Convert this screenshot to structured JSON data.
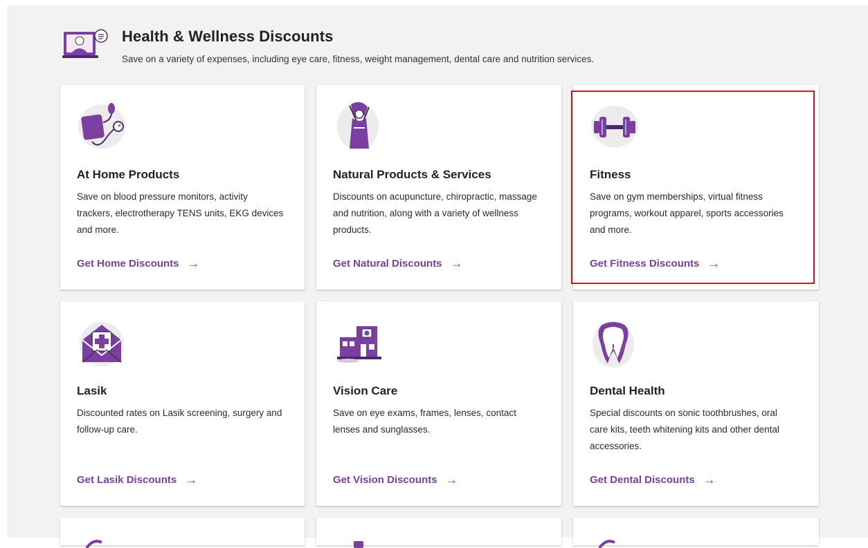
{
  "header": {
    "title": "Health & Wellness Discounts",
    "subtitle": "Save on a variety of expenses, including eye care, fitness, weight management, dental care and nutrition services.",
    "icon": "virtual-doctor-icon"
  },
  "colors": {
    "accent": "#7a3fa0",
    "icon_purple": "#6b2f8f",
    "highlight": "#e01010",
    "background": "#f2f2f2"
  },
  "cards": [
    {
      "title": "At Home Products",
      "description": "Save on blood pressure monitors, activity trackers, electrotherapy TENS units, EKG devices and more.",
      "link": "Get Home Discounts",
      "icon": "blood-pressure-monitor-icon"
    },
    {
      "title": "Natural Products & Services",
      "description": "Discounts on acupuncture, chiropractic, massage and nutrition, along with a variety of wellness products.",
      "link": "Get Natural Discounts",
      "icon": "stretching-person-icon"
    },
    {
      "title": "Fitness",
      "description": "Save on gym memberships, virtual fitness programs, workout apparel, sports accessories and more.",
      "link": "Get Fitness Discounts",
      "icon": "dumbbell-icon"
    },
    {
      "title": "Lasik",
      "description": "Discounted rates on Lasik screening, surgery and follow-up care.",
      "link": "Get Lasik Discounts",
      "icon": "medical-envelope-icon"
    },
    {
      "title": "Vision Care",
      "description": "Save on eye exams, frames, lenses, contact lenses and sunglasses.",
      "link": "Get Vision Discounts",
      "icon": "clinic-building-icon"
    },
    {
      "title": "Dental Health",
      "description": "Special discounts on sonic toothbrushes, oral care kits, teeth whitening kits and other dental accessories.",
      "link": "Get Dental Discounts",
      "icon": "tooth-icon"
    }
  ],
  "arrow_glyph": "→"
}
